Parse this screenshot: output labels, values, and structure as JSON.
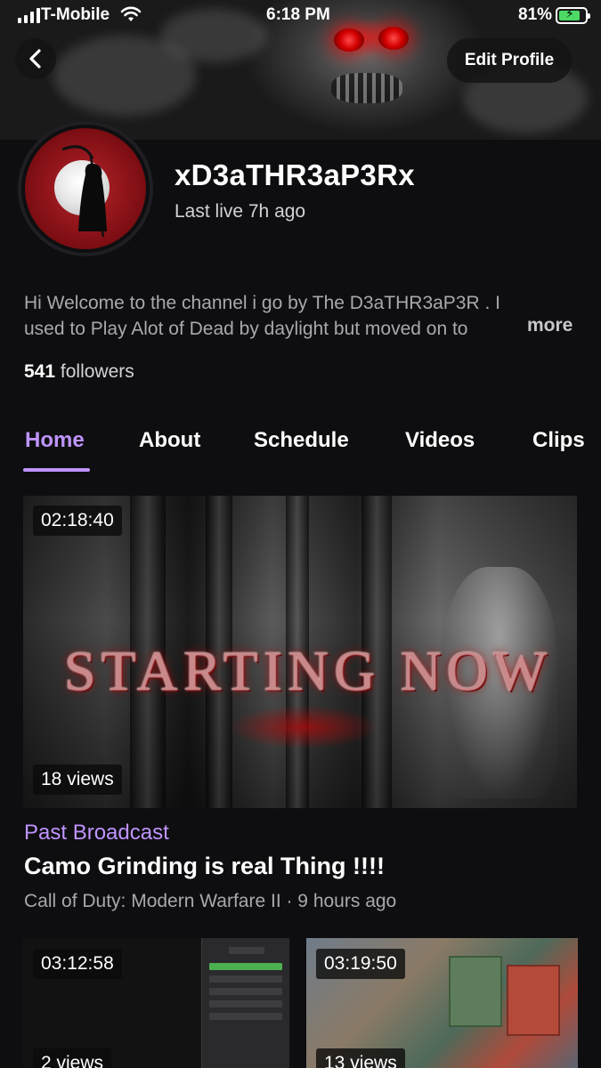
{
  "status_bar": {
    "carrier": "T-Mobile",
    "time": "6:18 PM",
    "battery_percent": "81%",
    "battery_level": 0.81,
    "charging": true,
    "icons": [
      "cellular-signal-icon",
      "wifi-icon",
      "battery-charging-icon"
    ]
  },
  "header": {
    "back_icon": "chevron-left-icon",
    "edit_profile_label": "Edit Profile"
  },
  "profile": {
    "channel_name": "xD3aTHR3aP3Rx",
    "last_live": "Last live 7h ago",
    "bio_line1": "Hi Welcome to the channel i go by The D3aTHR3aP3R . I",
    "bio_line2": "used to Play Alot of Dead by daylight but moved on to",
    "more_label": "more",
    "followers_count": "541",
    "followers_label": "followers"
  },
  "tabs": [
    {
      "label": "Home",
      "active": true
    },
    {
      "label": "About",
      "active": false
    },
    {
      "label": "Schedule",
      "active": false
    },
    {
      "label": "Videos",
      "active": false
    },
    {
      "label": "Clips",
      "active": false
    }
  ],
  "featured_video": {
    "duration": "02:18:40",
    "views": "18 views",
    "thumbnail_text": "STARTING NOW",
    "type": "Past Broadcast",
    "title": "Camo Grinding is real Thing !!!!",
    "meta": "Call of Duty: Modern Warfare II · 9 hours ago"
  },
  "more_videos": [
    {
      "duration": "03:12:58",
      "views": "2 views"
    },
    {
      "duration": "03:19:50",
      "views": "13 views"
    }
  ],
  "colors": {
    "background": "#0e0e10",
    "accent": "#bf94ff",
    "text_primary": "#ffffff",
    "text_secondary": "#a8a8ae"
  }
}
